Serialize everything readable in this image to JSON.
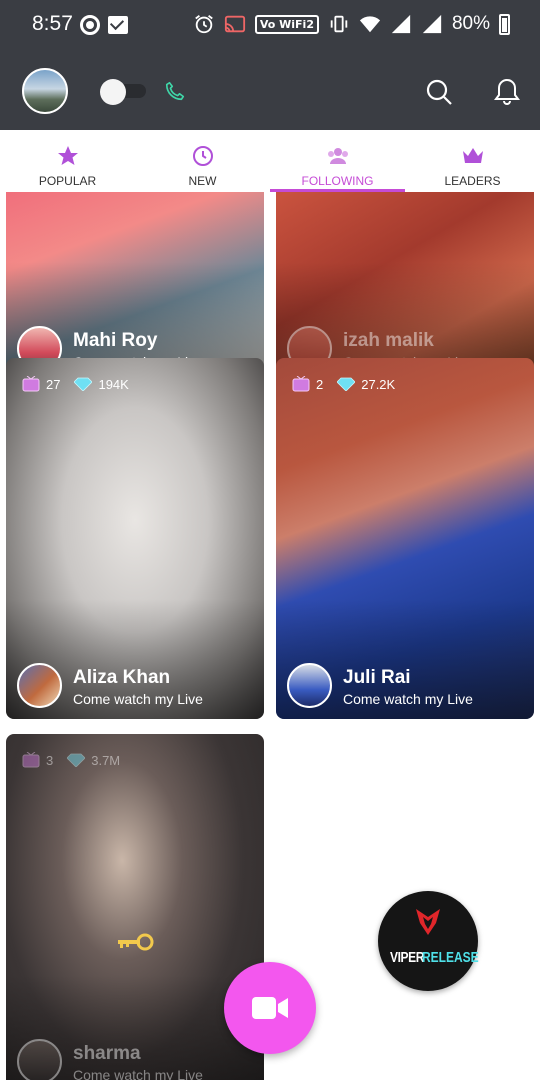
{
  "status_bar": {
    "time": "8:57",
    "network_label": "Vo WiFi2",
    "battery_percent": "80%"
  },
  "tabs": [
    {
      "label": "POPULAR",
      "icon": "star-icon",
      "active": false
    },
    {
      "label": "NEW",
      "icon": "clock-icon",
      "active": false
    },
    {
      "label": "FOLLOWING",
      "icon": "group-icon",
      "active": true
    },
    {
      "label": "LEADERS",
      "icon": "crown-icon",
      "active": false
    }
  ],
  "cards": [
    {
      "name": "Mahi Roy",
      "subtitle": "Come watch my Live"
    },
    {
      "name": "izah malik",
      "subtitle": "Come watch my Live"
    },
    {
      "name": "Aliza Khan",
      "subtitle": "Come watch my Live",
      "viewers": "27",
      "diamonds": "194K"
    },
    {
      "name": "Juli Rai",
      "subtitle": "Come watch my Live",
      "viewers": "2",
      "diamonds": "27.2K"
    },
    {
      "name": "sharma",
      "subtitle": "Come watch my Live",
      "viewers": "3",
      "diamonds": "3.7M"
    }
  ],
  "watermark": {
    "word1": "VIPER",
    "word2": "RELEASE"
  },
  "colors": {
    "accent": "#c54bd6",
    "fab": "#f357ee",
    "header": "#3a3d43"
  }
}
